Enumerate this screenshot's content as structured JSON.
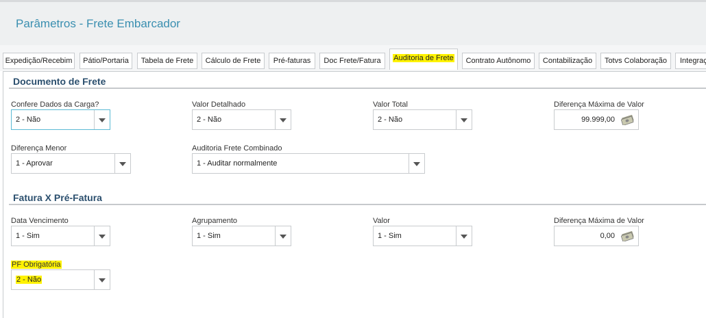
{
  "header": {
    "title": "Parâmetros - Frete Embarcador"
  },
  "tabs": [
    {
      "label": "Expedição/Recebim"
    },
    {
      "label": "Pátio/Portaria"
    },
    {
      "label": "Tabela de Frete"
    },
    {
      "label": "Cálculo de Frete"
    },
    {
      "label": "Pré-faturas"
    },
    {
      "label": "Doc Frete/Fatura"
    },
    {
      "label": "Auditoria de Frete",
      "active": true
    },
    {
      "label": "Contrato Autônomo"
    },
    {
      "label": "Contabilização"
    },
    {
      "label": "Totvs Colaboração"
    },
    {
      "label": "Integraç"
    }
  ],
  "documento_frete": {
    "title": "Documento de Frete",
    "confere_dados": {
      "label": "Confere Dados da Carga?",
      "value": "2 - Não"
    },
    "valor_detalhado": {
      "label": "Valor Detalhado",
      "value": "2 - Não"
    },
    "valor_total": {
      "label": "Valor Total",
      "value": "2 - Não"
    },
    "diferenca_maxima": {
      "label": "Diferença Máxima de Valor",
      "value": "99.999,00"
    },
    "diferenca_menor": {
      "label": "Diferença Menor",
      "value": "1 - Aprovar"
    },
    "auditoria_combinado": {
      "label": "Auditoria Frete Combinado",
      "value": "1 - Auditar normalmente"
    }
  },
  "fatura_pre_fatura": {
    "title": "Fatura X Pré-Fatura",
    "data_vencimento": {
      "label": "Data Vencimento",
      "value": "1 - Sim"
    },
    "agrupamento": {
      "label": "Agrupamento",
      "value": "1 - Sim"
    },
    "valor": {
      "label": "Valor",
      "value": "1 - Sim"
    },
    "diferenca_maxima": {
      "label": "Diferença Máxima de Valor",
      "value": "0,00"
    },
    "pf_obrigatoria": {
      "label": "PF Obrigatória",
      "value": "2 - Não"
    }
  },
  "colors": {
    "title": "#3a8fb0",
    "section": "#2b4f6e",
    "highlight": "#fff200",
    "focus": "#5bbad5"
  },
  "icons": [
    "chevron-down-icon",
    "money-icon"
  ]
}
